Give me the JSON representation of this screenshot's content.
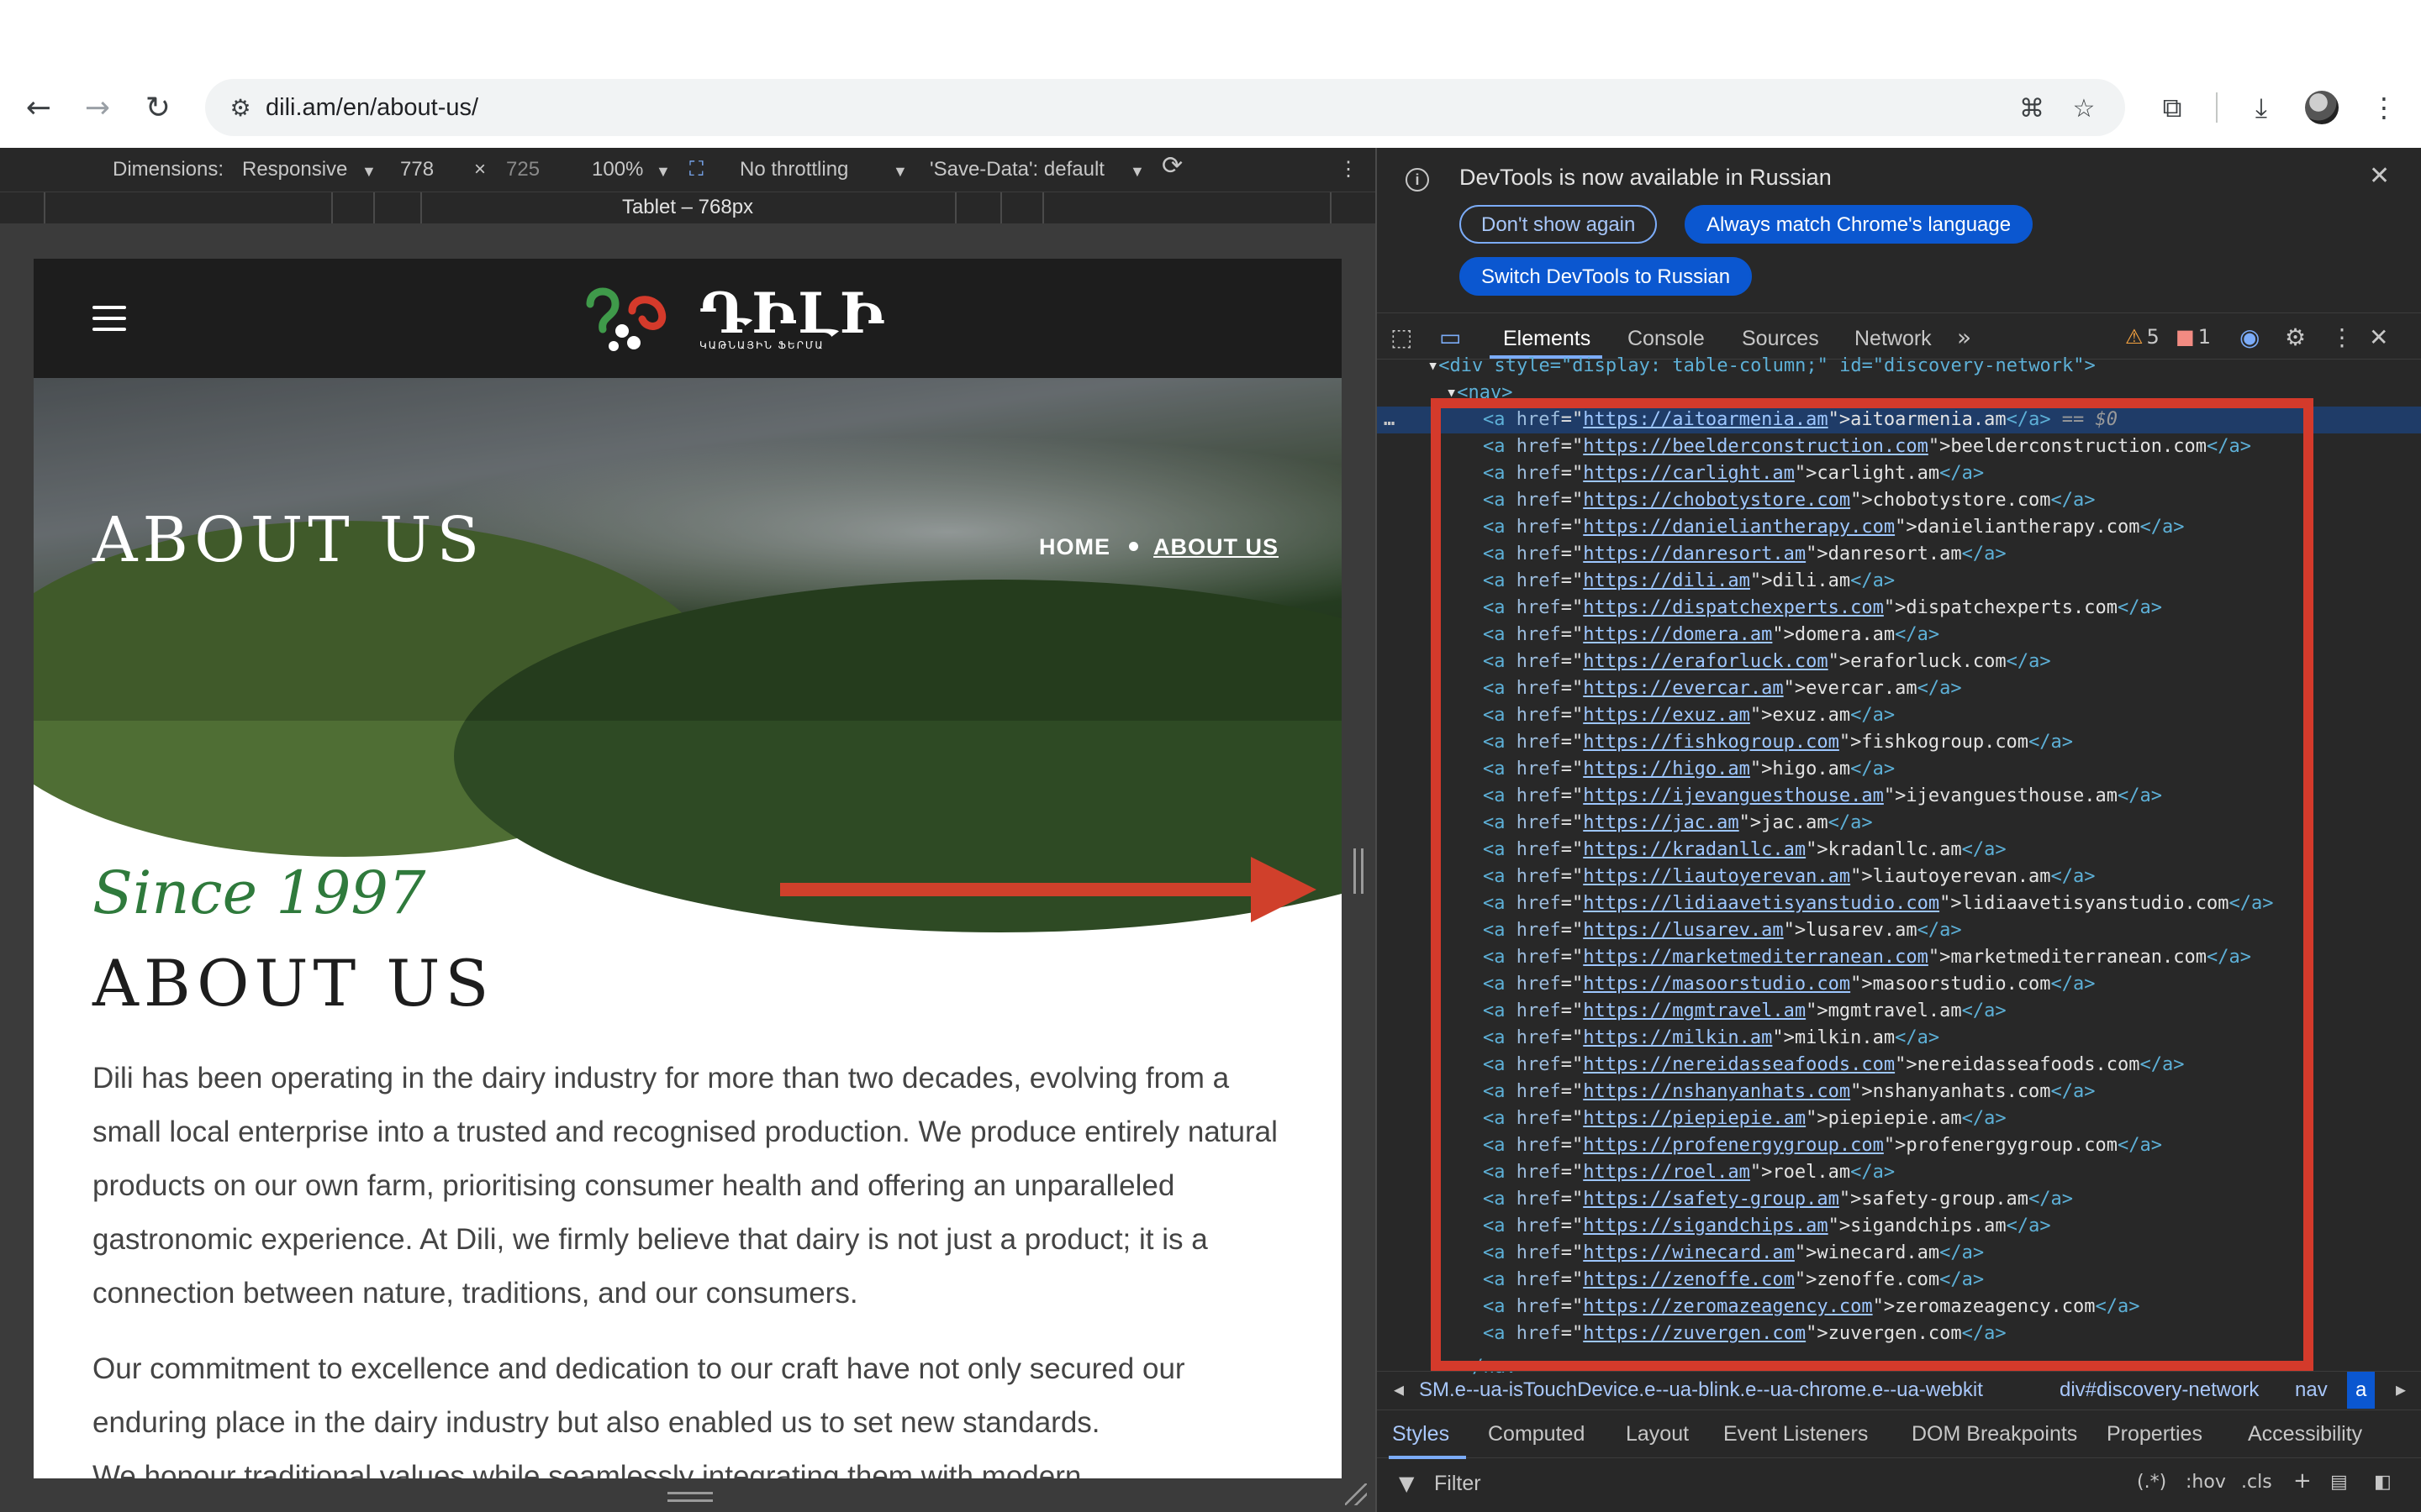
{
  "browser": {
    "url": "dili.am/en/about-us/",
    "icons": [
      "back-icon",
      "forward-icon",
      "reload-icon",
      "site-settings-icon",
      "translate-icon",
      "bookmark-star-icon",
      "extensions-icon",
      "download-icon",
      "profile-avatar",
      "more-menu-icon"
    ]
  },
  "device_toolbar": {
    "dimensions_label": "Dimensions:",
    "device": "Responsive",
    "width": "778",
    "times": "×",
    "height": "725",
    "zoom": "100%",
    "throttling": "No throttling",
    "save_data": "'Save-Data': default",
    "media_query_label": "Tablet – 768px"
  },
  "site": {
    "logo_text": "ԴԻԼԻ",
    "logo_sub": "ԿԱԹՆԱՅԻՆ ՖԵՐՄԱ",
    "hero_title": "ABOUT US",
    "breadcrumb": [
      "HOME",
      "ABOUT US"
    ],
    "since": "Since 1997",
    "heading": "ABOUT US",
    "paragraph1": "Dili has been operating in the dairy industry for more than two decades, evolving from a small local enterprise into a trusted and recognised production. We produce entirely natural products on our own farm, prioritising consumer health and offering an unparalleled gastronomic experience. At Dili, we firmly believe that dairy is not just a product; it is a connection between nature, traditions, and our consumers.",
    "paragraph2": "Our commitment to excellence and dedication to our craft have not only secured our enduring place in the dairy industry but also enabled us to set new standards.",
    "paragraph3_partial": "We honour traditional values while seamlessly integrating them with modern"
  },
  "annotation": {
    "arrow_color": "#d0402b",
    "box_color": "#d43a2b"
  },
  "devtools": {
    "infobar": {
      "message": "DevTools is now available in Russian",
      "btn_dont_show": "Don't show again",
      "btn_always_match": "Always match Chrome's language",
      "btn_switch": "Switch DevTools to Russian"
    },
    "tabs": [
      "Elements",
      "Console",
      "Sources",
      "Network"
    ],
    "warnings": "5",
    "errors": "1",
    "elements": {
      "div_open": "<div style=\"display: table-column;\" id=\"discovery-network\">",
      "nav_open": "<nav>",
      "nav_close": "</nav>",
      "selected_suffix": "== $0",
      "links": [
        {
          "href": "https://aitoarmenia.am",
          "text": "aitoarmenia.am"
        },
        {
          "href": "https://beelderconstruction.com",
          "text": "beelderconstruction.com"
        },
        {
          "href": "https://carlight.am",
          "text": "carlight.am"
        },
        {
          "href": "https://chobotystore.com",
          "text": "chobotystore.com"
        },
        {
          "href": "https://danieliantherapy.com",
          "text": "danieliantherapy.com"
        },
        {
          "href": "https://danresort.am",
          "text": "danresort.am"
        },
        {
          "href": "https://dili.am",
          "text": "dili.am"
        },
        {
          "href": "https://dispatchexperts.com",
          "text": "dispatchexperts.com"
        },
        {
          "href": "https://domera.am",
          "text": "domera.am"
        },
        {
          "href": "https://eraforluck.com",
          "text": "eraforluck.com"
        },
        {
          "href": "https://evercar.am",
          "text": "evercar.am"
        },
        {
          "href": "https://exuz.am",
          "text": "exuz.am"
        },
        {
          "href": "https://fishkogroup.com",
          "text": "fishkogroup.com"
        },
        {
          "href": "https://higo.am",
          "text": "higo.am"
        },
        {
          "href": "https://ijevanguesthouse.am",
          "text": "ijevanguesthouse.am"
        },
        {
          "href": "https://jac.am",
          "text": "jac.am"
        },
        {
          "href": "https://kradanllc.am",
          "text": "kradanllc.am"
        },
        {
          "href": "https://liautoyerevan.am",
          "text": "liautoyerevan.am"
        },
        {
          "href": "https://lidiaavetisyanstudio.com",
          "text": "lidiaavetisyanstudio.com"
        },
        {
          "href": "https://lusarev.am",
          "text": "lusarev.am"
        },
        {
          "href": "https://marketmediterranean.com",
          "text": "marketmediterranean.com"
        },
        {
          "href": "https://masoorstudio.com",
          "text": "masoorstudio.com"
        },
        {
          "href": "https://mgmtravel.am",
          "text": "mgmtravel.am"
        },
        {
          "href": "https://milkin.am",
          "text": "milkin.am"
        },
        {
          "href": "https://nereidasseafoods.com",
          "text": "nereidasseafoods.com"
        },
        {
          "href": "https://nshanyanhats.com",
          "text": "nshanyanhats.com"
        },
        {
          "href": "https://piepiepie.am",
          "text": "piepiepie.am"
        },
        {
          "href": "https://profenergygroup.com",
          "text": "profenergygroup.com"
        },
        {
          "href": "https://roel.am",
          "text": "roel.am"
        },
        {
          "href": "https://safety-group.am",
          "text": "safety-group.am"
        },
        {
          "href": "https://sigandchips.am",
          "text": "sigandchips.am"
        },
        {
          "href": "https://winecard.am",
          "text": "winecard.am"
        },
        {
          "href": "https://zenoffe.com",
          "text": "zenoffe.com"
        },
        {
          "href": "https://zeromazeagency.com",
          "text": "zeromazeagency.com"
        },
        {
          "href": "https://zuvergen.com",
          "text": "zuvergen.com"
        }
      ]
    },
    "breadcrumbs": [
      "SM.e--ua-isTouchDevice.e--ua-blink.e--ua-chrome.e--ua-webkit",
      "div#discovery-network",
      "nav",
      "a"
    ],
    "bottom_tabs": [
      "Styles",
      "Computed",
      "Layout",
      "Event Listeners",
      "DOM Breakpoints",
      "Properties",
      "Accessibility"
    ],
    "filter_placeholder": "Filter",
    "filter_controls": [
      ":hov",
      ".cls"
    ]
  }
}
